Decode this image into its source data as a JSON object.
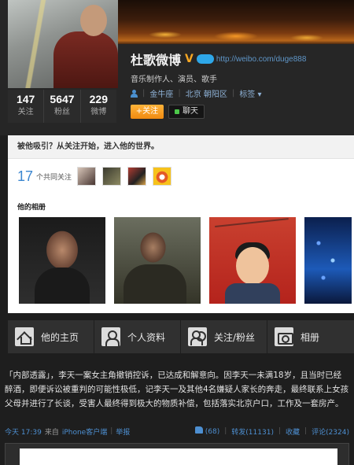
{
  "profile": {
    "name": "杜歌微博",
    "verified_mark": "V",
    "url": "http://weibo.com/duge888",
    "description": "音乐制作人、演员、歌手",
    "zodiac": "金牛座",
    "location": "北京 朝阳区",
    "tags_label": "标签 ▾",
    "follow_label": "+关注",
    "chat_label": "聊天",
    "stats": [
      {
        "value": "147",
        "label": "关注"
      },
      {
        "value": "5647",
        "label": "粉丝"
      },
      {
        "value": "229",
        "label": "微博"
      }
    ]
  },
  "recommend": {
    "heading": "被他吸引？从关注开始，进入他的世界。",
    "common_count": "17",
    "common_label": "个共同关注",
    "album_title": "他的相册"
  },
  "tabs": [
    {
      "label": "他的主页",
      "icon": "home-icon"
    },
    {
      "label": "个人资料",
      "icon": "person-icon"
    },
    {
      "label": "关注/粉丝",
      "icon": "people-icon"
    },
    {
      "label": "相册",
      "icon": "camera-icon"
    }
  ],
  "post": {
    "text": "「内部透露」，李天一案女主角撤销控诉，已达成和解意向。因李天一未满18岁，且当时已经醉酒，即便诉讼被重判的可能性极低，记李天一及其他4名嫌疑人家长的奔走，最终联系上女孩父母并进行了长谈，受害人最终得到极大的物质补偿，包括落实北京户口，工作及一套房产。",
    "time": "今天 17:39",
    "source_prefix": "来自",
    "source": "iPhone客户端",
    "report": "举报",
    "likes": "(68)",
    "repost": "转发(11131)",
    "favorite": "收藏",
    "comment": "评论(2324)"
  }
}
